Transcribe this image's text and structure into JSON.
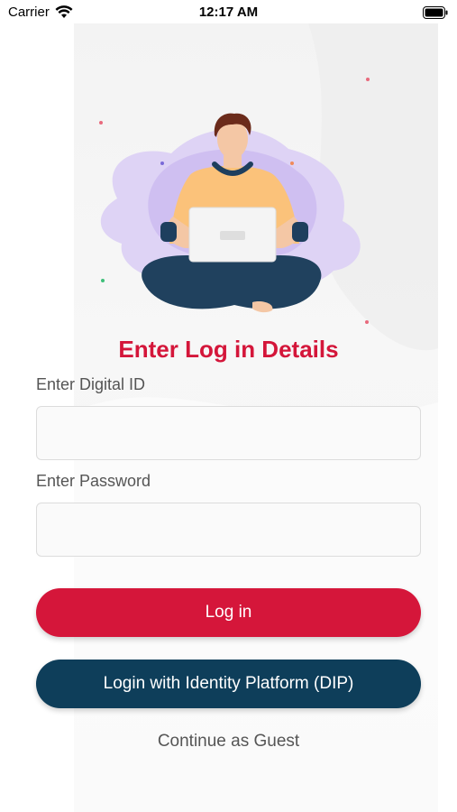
{
  "status_bar": {
    "carrier": "Carrier",
    "time": "12:17 AM",
    "wifi_icon": "wifi-icon",
    "battery_icon": "battery-icon"
  },
  "illustration": {
    "icon": "person-with-laptop-illustration"
  },
  "login": {
    "title": "Enter Log in Details",
    "digital_id_label": "Enter Digital ID",
    "digital_id_value": "",
    "password_label": "Enter Password",
    "password_value": "",
    "login_button": "Log in",
    "dip_button": "Login with Identity Platform (DIP)",
    "guest_link": "Continue as Guest"
  },
  "colors": {
    "primary_red": "#d5163a",
    "dark_navy": "#0e3e5a",
    "label_gray": "#555555"
  }
}
